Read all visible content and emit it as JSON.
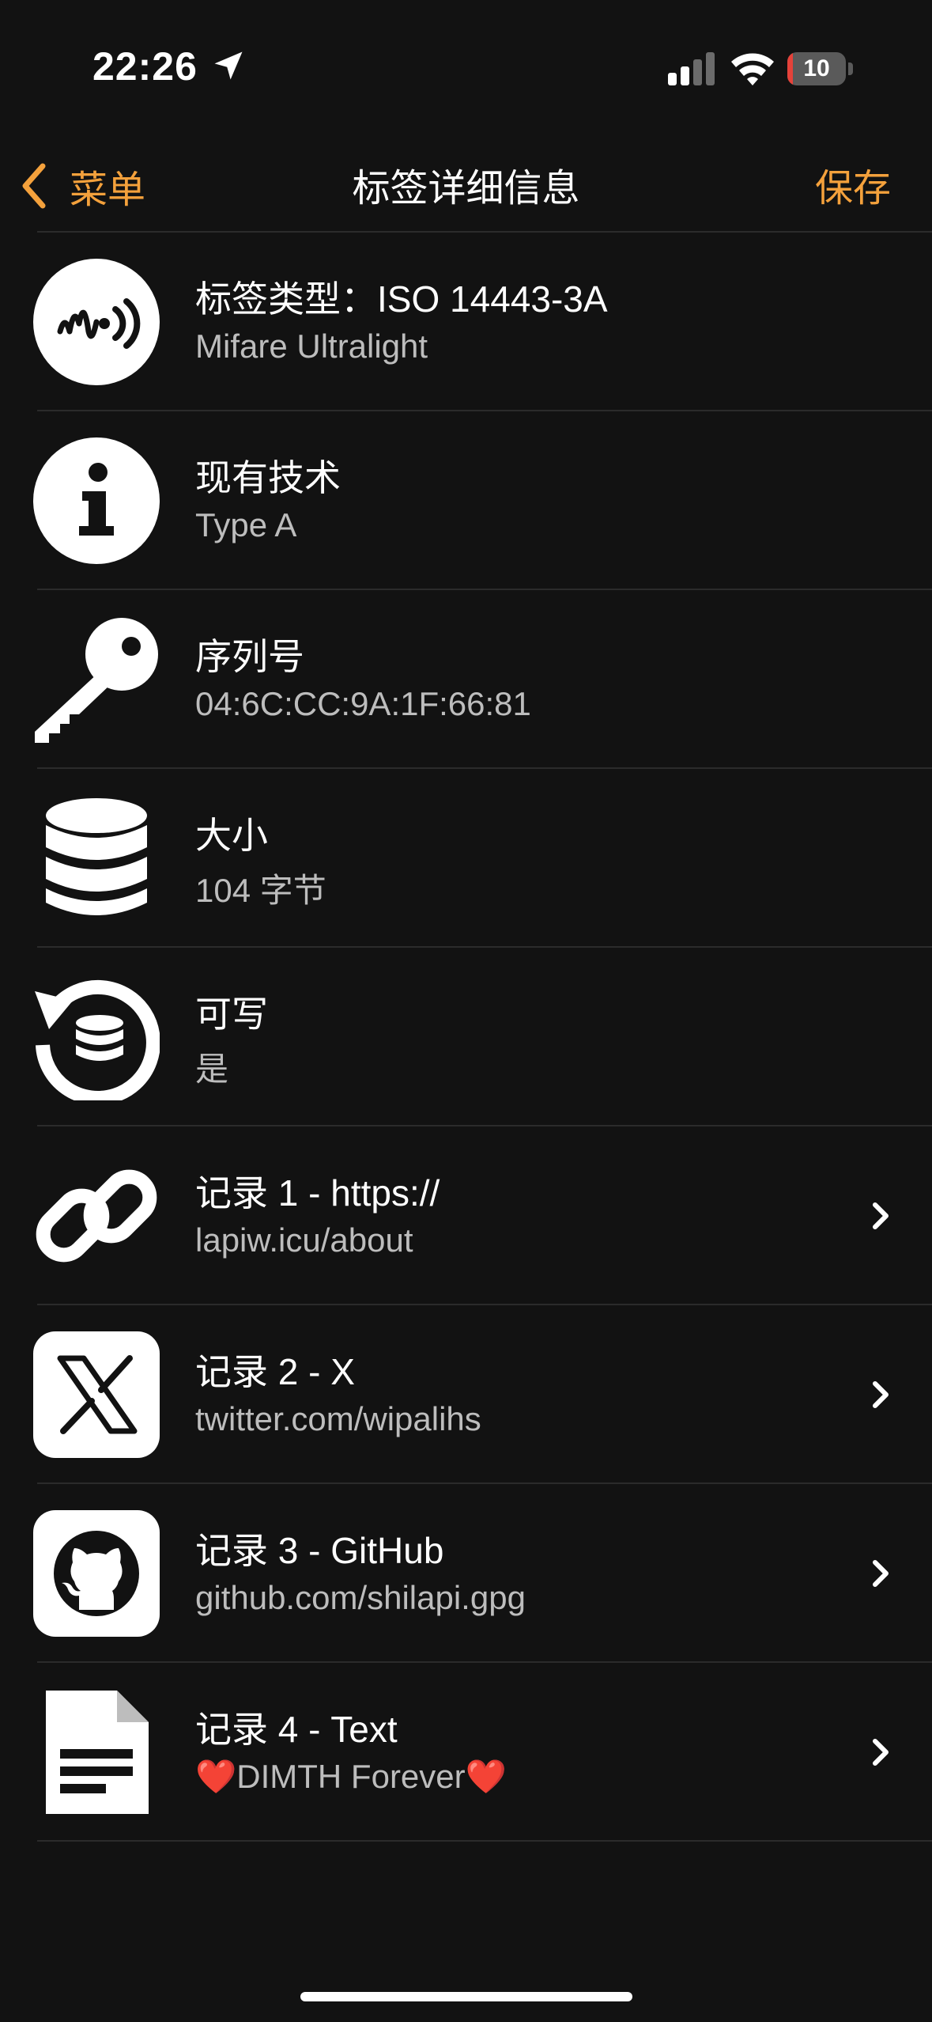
{
  "status": {
    "time": "22:26",
    "battery": "10",
    "battery_level": 0.1
  },
  "nav": {
    "back_label": "菜单",
    "title": "标签详细信息",
    "save_label": "保存"
  },
  "rows": [
    {
      "icon": "nfc-wave-icon",
      "title": "标签类型：ISO 14443-3A",
      "subtitle": "Mifare Ultralight",
      "link": false
    },
    {
      "icon": "info-icon",
      "title": "现有技术",
      "subtitle": "Type A",
      "link": false
    },
    {
      "icon": "key-icon",
      "title": "序列号",
      "subtitle": "04:6C:CC:9A:1F:66:81",
      "link": false
    },
    {
      "icon": "database-icon",
      "title": "大小",
      "subtitle": "104 字节",
      "link": false
    },
    {
      "icon": "rewrite-database-icon",
      "title": "可写",
      "subtitle": "是",
      "link": false
    },
    {
      "icon": "link-icon",
      "title": "记录 1 - https://",
      "subtitle": "lapiw.icu/about",
      "link": true
    },
    {
      "icon": "x-logo-icon",
      "title": "记录 2 - X",
      "subtitle": "twitter.com/wipalihs",
      "link": true
    },
    {
      "icon": "github-icon",
      "title": "记录 3 - GitHub",
      "subtitle": "github.com/shilapi.gpg",
      "link": true
    },
    {
      "icon": "document-icon",
      "title": "记录 4 - Text",
      "subtitle": "❤️DIMTH Forever❤️",
      "link": true
    }
  ],
  "colors": {
    "accent": "#f4a13c",
    "background": "#121212",
    "separator": "#2b2b2b",
    "battery_low": "#e5423a"
  }
}
